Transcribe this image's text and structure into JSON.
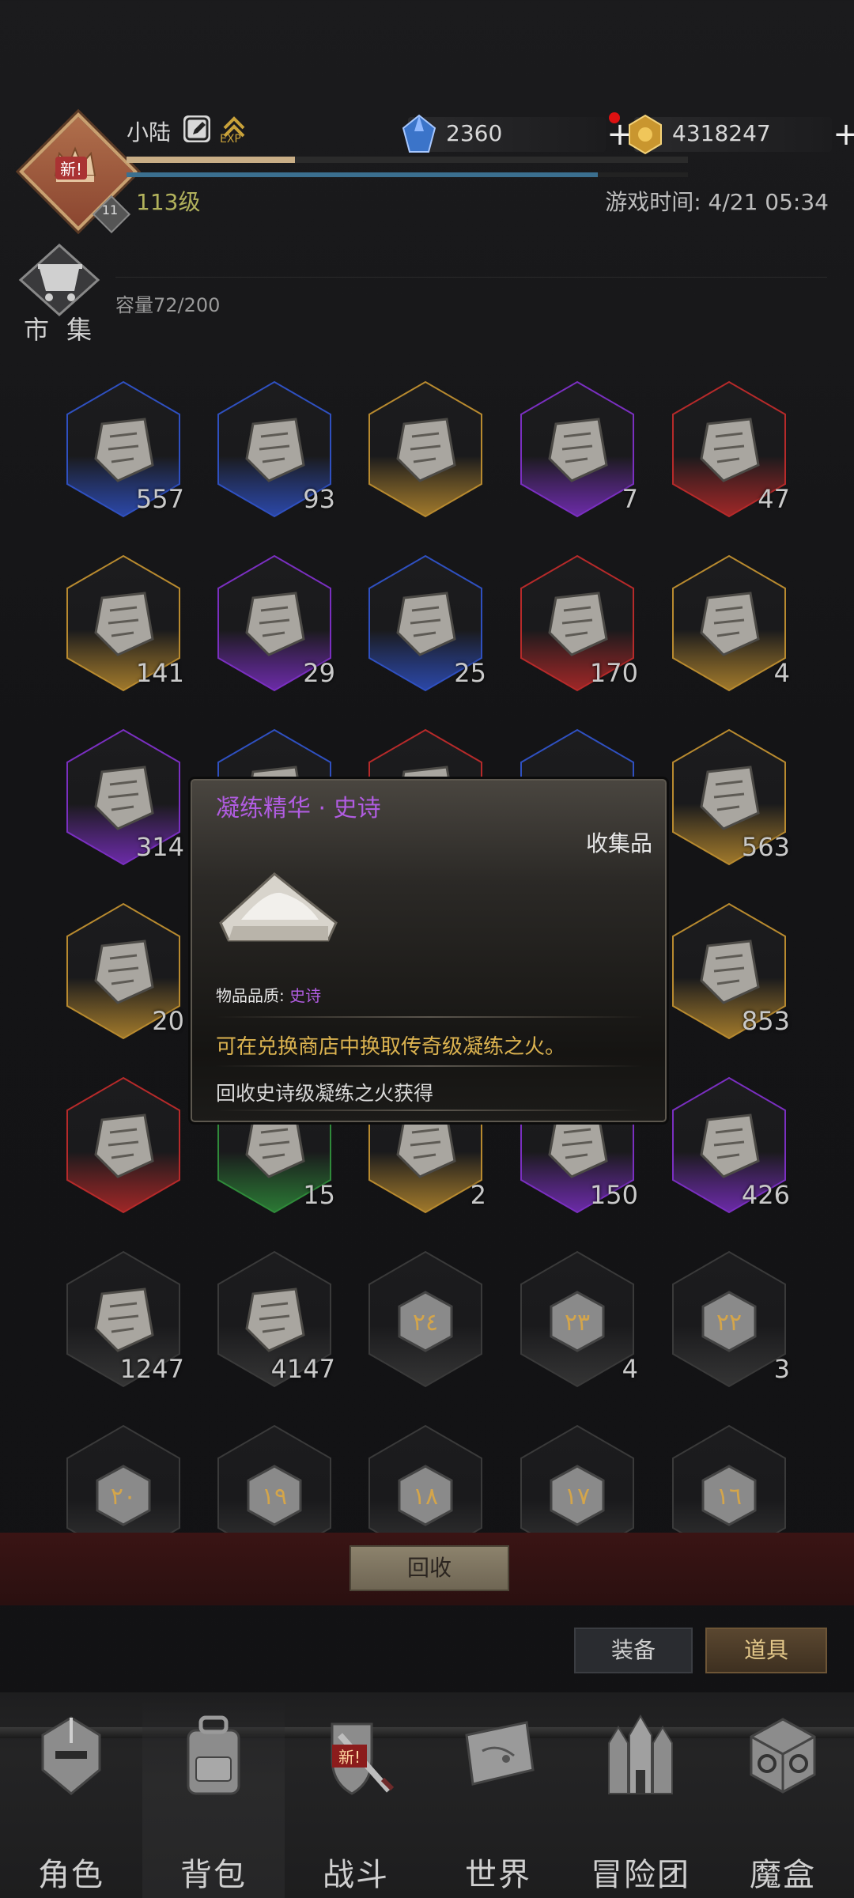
{
  "header": {
    "player_name": "小陆",
    "exp_label": "EXP",
    "level": "113级",
    "avatar_badge": "新!",
    "avatar_level_chip": "11",
    "game_time": "游戏时间: 4/21 05:34",
    "exp_progress": 0.3,
    "hp_progress": 0.84,
    "currencies": {
      "diamond": "2360",
      "gold": "4318247"
    }
  },
  "market": {
    "label": "市 集",
    "capacity": "容量72/200"
  },
  "grid": {
    "items": [
      {
        "count": "557",
        "rarity": "rare",
        "icon": "bowl-icon"
      },
      {
        "count": "93",
        "rarity": "rare",
        "icon": "pocket-watch-icon"
      },
      {
        "count": "",
        "rarity": "legendary",
        "icon": "mask-icon"
      },
      {
        "count": "7",
        "rarity": "epic",
        "icon": "chalice-icon"
      },
      {
        "count": "47",
        "rarity": "mythic",
        "icon": "rune-tablet-icon"
      },
      {
        "count": "141",
        "rarity": "legendary",
        "icon": "rune-tablet-icon"
      },
      {
        "count": "29",
        "rarity": "epic",
        "icon": "rune-tablet-icon"
      },
      {
        "count": "25",
        "rarity": "rare",
        "icon": "rune-tablet-icon"
      },
      {
        "count": "170",
        "rarity": "mythic",
        "icon": "carved-stone-icon"
      },
      {
        "count": "4",
        "rarity": "legendary",
        "icon": "claw-banner-icon"
      },
      {
        "count": "314",
        "rarity": "epic",
        "icon": "leaf-gem-icon"
      },
      {
        "count": "",
        "rarity": "rare",
        "icon": "incense-icon"
      },
      {
        "count": "",
        "rarity": "mythic",
        "icon": "spiky-ore-icon"
      },
      {
        "count": "",
        "rarity": "rare",
        "icon": "unknown-icon"
      },
      {
        "count": "563",
        "rarity": "legendary",
        "icon": "crystal-shard-icon"
      },
      {
        "count": "20",
        "rarity": "legendary",
        "icon": "crystal-shard-icon"
      },
      {
        "count": "",
        "rarity": "rare",
        "icon": "unknown-icon"
      },
      {
        "count": "",
        "rarity": "rare",
        "icon": "unknown-icon"
      },
      {
        "count": "",
        "rarity": "rare",
        "icon": "unknown-icon"
      },
      {
        "count": "853",
        "rarity": "legendary",
        "icon": "emblem-icon"
      },
      {
        "count": "",
        "rarity": "mythic",
        "icon": "potion-bottle-icon"
      },
      {
        "count": "15",
        "rarity": "uncommon",
        "icon": "feather-quill-icon"
      },
      {
        "count": "2",
        "rarity": "legendary",
        "icon": "crossed-swords-shield-icon"
      },
      {
        "count": "150",
        "rarity": "epic",
        "icon": "blue-tapestry-icon"
      },
      {
        "count": "426",
        "rarity": "epic",
        "icon": "rubble-icon"
      },
      {
        "count": "1247",
        "rarity": "common",
        "icon": "shard-icon"
      },
      {
        "count": "4147",
        "rarity": "common",
        "icon": "crystal-icon"
      },
      {
        "count": "",
        "rarity": "common",
        "icon": "numbered-cube-icon",
        "glyph": "٢٤"
      },
      {
        "count": "4",
        "rarity": "common",
        "icon": "numbered-cube-icon",
        "glyph": "٢٣"
      },
      {
        "count": "3",
        "rarity": "common",
        "icon": "numbered-cube-icon",
        "glyph": "٢٢"
      },
      {
        "count": "",
        "rarity": "common",
        "icon": "numbered-cube-icon",
        "glyph": "٢٠"
      },
      {
        "count": "",
        "rarity": "common",
        "icon": "numbered-cube-icon",
        "glyph": "١٩"
      },
      {
        "count": "",
        "rarity": "common",
        "icon": "numbered-cube-icon",
        "glyph": "١٨"
      },
      {
        "count": "",
        "rarity": "common",
        "icon": "numbered-cube-icon",
        "glyph": "١٧"
      },
      {
        "count": "",
        "rarity": "common",
        "icon": "numbered-cube-icon",
        "glyph": "١٦"
      }
    ],
    "rarity_colors": {
      "common": "#3a3a3a",
      "uncommon": "#2f8a3a",
      "rare": "#2f50c0",
      "epic": "#7a2fc0",
      "legendary": "#b88a2f",
      "mythic": "#b62a2a"
    }
  },
  "tooltip": {
    "title": "凝练精华 · 史诗",
    "category": "收集品",
    "quality_label": "物品品质: ",
    "quality_value": "史诗",
    "description": "可在兑换商店中换取传奇级凝练之火。",
    "source": "回收史诗级凝练之火获得",
    "title_color": "#b05ce0"
  },
  "actions": {
    "recycle": "回收",
    "filter_equipment": "装备",
    "filter_items": "道具"
  },
  "nav": {
    "tabs": [
      {
        "label": "角色",
        "icon": "helmet-icon"
      },
      {
        "label": "背包",
        "icon": "backpack-icon"
      },
      {
        "label": "战斗",
        "icon": "sword-shield-icon"
      },
      {
        "label": "世界",
        "icon": "map-scroll-icon"
      },
      {
        "label": "冒险团",
        "icon": "castle-icon"
      },
      {
        "label": "魔盒",
        "icon": "magic-cube-icon"
      }
    ],
    "battle_badge": "新!"
  }
}
